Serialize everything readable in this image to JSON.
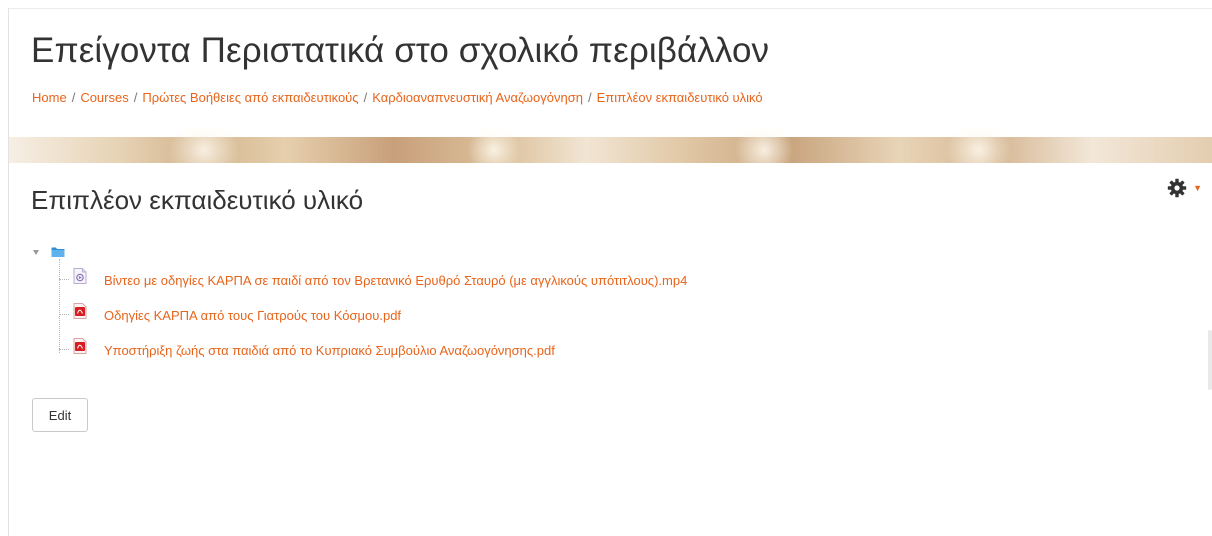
{
  "header": {
    "course_title": "Επείγοντα Περιστατικά στο σχολικό περιβάλλον",
    "breadcrumb": [
      "Home",
      "Courses",
      "Πρώτες Βοήθειες από εκπαιδευτικούς",
      "Καρδιοαναπνευστική Αναζωογόνηση",
      "Επιπλέον εκπαιδευτικό υλικό"
    ],
    "breadcrumb_separator": "/"
  },
  "main": {
    "activity_title": "Επιπλέον εκπαιδευτικό υλικό",
    "settings_icon": "gear-icon",
    "settings_caret": "▼",
    "folder": {
      "icon": "folder-icon",
      "expanded": true,
      "files": [
        {
          "name": "Βίντεο με οδηγίες ΚΑΡΠΑ σε παιδί από τον Βρετανικό Ερυθρό Σταυρό (με αγγλικούς υπότιτλους).mp4",
          "icon": "video-file-icon"
        },
        {
          "name": "Οδηγίες ΚΑΡΠΑ από τους Γιατρούς του Κόσμου.pdf",
          "icon": "pdf-file-icon"
        },
        {
          "name": "Υποστήριξη ζωής στα παιδιά από το Κυπριακό Συμβούλιο Αναζωογόνησης.pdf",
          "icon": "pdf-file-icon"
        }
      ]
    },
    "edit_button_label": "Edit"
  },
  "colors": {
    "link": "#e8641b",
    "title_text": "#333333"
  }
}
